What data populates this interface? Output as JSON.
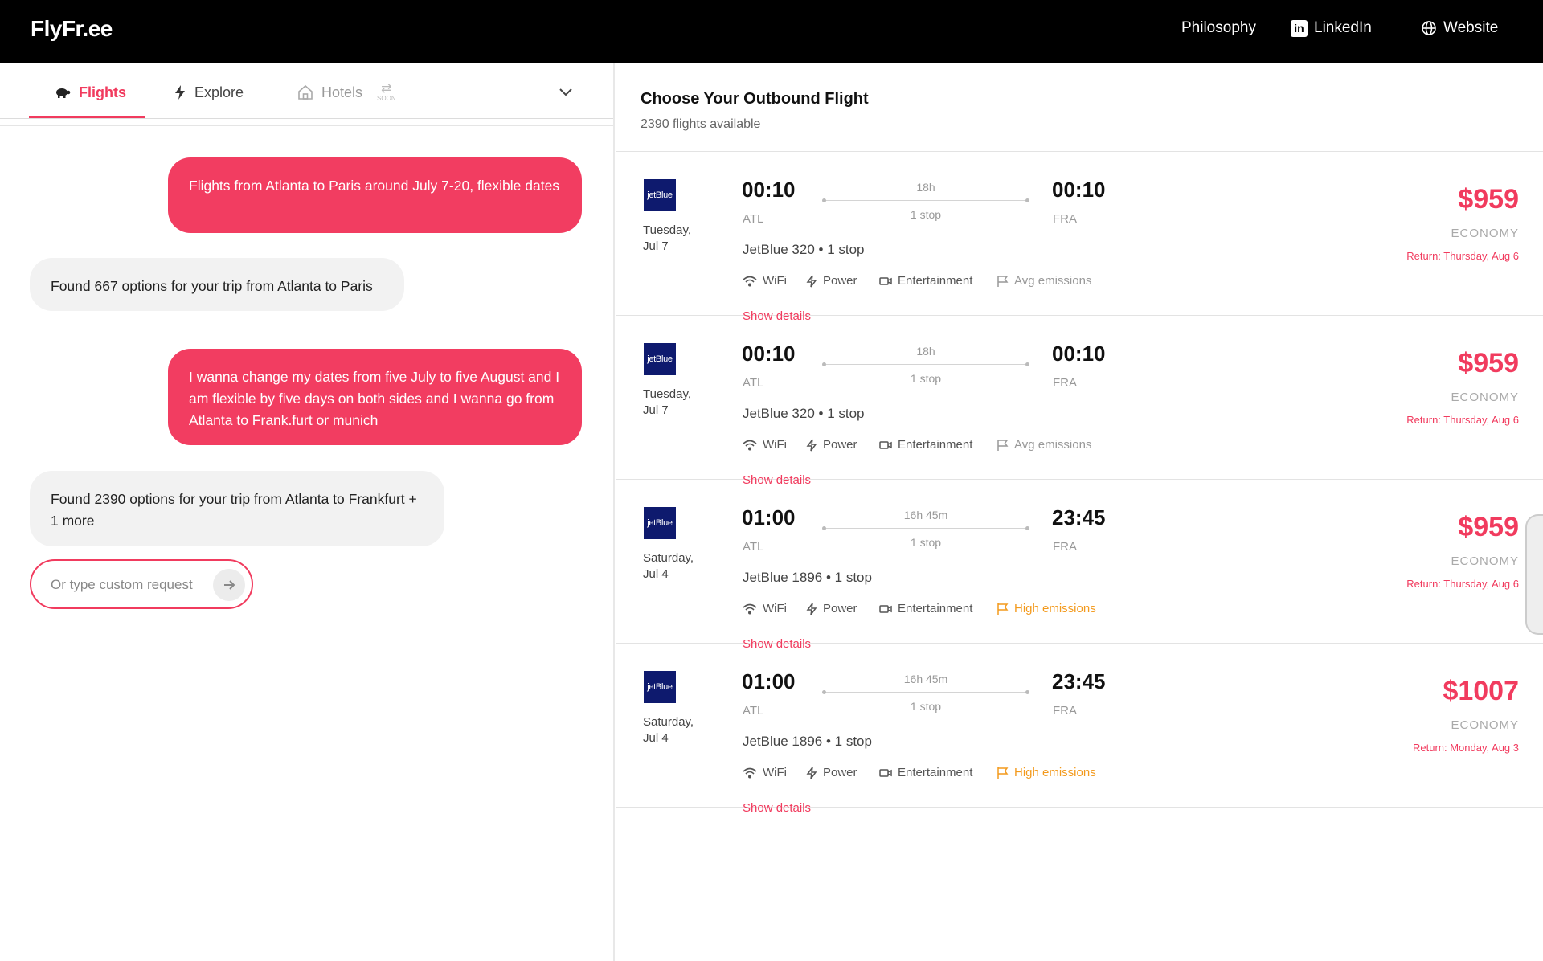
{
  "app": {
    "logo": "FlyFr.ee",
    "nav": {
      "philosophy": "Philosophy",
      "linkedin": "LinkedIn",
      "website": "Website"
    }
  },
  "left": {
    "tabs": {
      "flights": "Flights",
      "explore": "Explore",
      "hotels": "Hotels",
      "hotels_badge": "SOON"
    },
    "messages": [
      {
        "role": "user",
        "text": "Flights from Atlanta to Paris around July 7-20, flexible dates"
      },
      {
        "role": "bot",
        "text": "Found 667 options for your trip from Atlanta to Paris"
      },
      {
        "role": "user",
        "text": "I wanna change my dates from five July to five August and I am flexible by five days on both sides and I wanna go from Atlanta to Frank.furt or munich"
      },
      {
        "role": "bot",
        "text": "Found 2390 options for your trip from Atlanta to Frankfurt + 1 more"
      }
    ],
    "request_input": {
      "placeholder": "Or type custom request",
      "value": ""
    }
  },
  "right": {
    "title": "Choose Your Outbound Flight",
    "subtitle": "2390 flights available",
    "show_details_label": "Show details",
    "amenities": {
      "wifi": "WiFi",
      "power": "Power",
      "entertainment": "Entertainment"
    },
    "colors": {
      "accent": "#f13b5e",
      "high_emissions": "#f39a1d",
      "airline_logo": "#0e1a6e"
    },
    "flights": [
      {
        "airline_logo_text": "jetBlue",
        "day": "Tuesday,",
        "date": "Jul 7",
        "dep_time": "00:10",
        "arr_time": "00:10",
        "dep_airport": "ATL",
        "arr_airport": "FRA",
        "duration": "18h",
        "stops": "1 stop",
        "flight_name": "JetBlue 320 • 1 stop",
        "emissions": "Avg emissions",
        "emissions_level": "avg",
        "price": "$959",
        "cabin": "ECONOMY",
        "return": "Return: Thursday, Aug 6"
      },
      {
        "airline_logo_text": "jetBlue",
        "day": "Tuesday,",
        "date": "Jul 7",
        "dep_time": "00:10",
        "arr_time": "00:10",
        "dep_airport": "ATL",
        "arr_airport": "FRA",
        "duration": "18h",
        "stops": "1 stop",
        "flight_name": "JetBlue 320 • 1 stop",
        "emissions": "Avg emissions",
        "emissions_level": "avg",
        "price": "$959",
        "cabin": "ECONOMY",
        "return": "Return: Thursday, Aug 6"
      },
      {
        "airline_logo_text": "jetBlue",
        "day": "Saturday,",
        "date": "Jul 4",
        "dep_time": "01:00",
        "arr_time": "23:45",
        "dep_airport": "ATL",
        "arr_airport": "FRA",
        "duration": "16h 45m",
        "stops": "1 stop",
        "flight_name": "JetBlue 1896 • 1 stop",
        "emissions": "High emissions",
        "emissions_level": "high",
        "price": "$959",
        "cabin": "ECONOMY",
        "return": "Return: Thursday, Aug 6"
      },
      {
        "airline_logo_text": "jetBlue",
        "day": "Saturday,",
        "date": "Jul 4",
        "dep_time": "01:00",
        "arr_time": "23:45",
        "dep_airport": "ATL",
        "arr_airport": "FRA",
        "duration": "16h 45m",
        "stops": "1 stop",
        "flight_name": "JetBlue 1896 • 1 stop",
        "emissions": "High emissions",
        "emissions_level": "high",
        "price": "$1007",
        "cabin": "ECONOMY",
        "return": "Return: Monday, Aug 3"
      }
    ]
  }
}
